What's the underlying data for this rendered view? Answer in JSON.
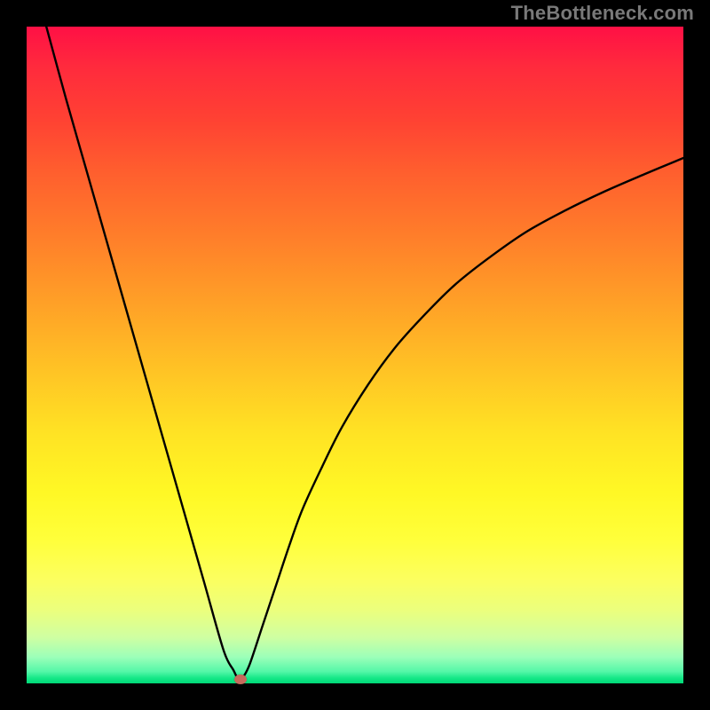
{
  "watermark": "TheBottleneck.com",
  "chart_data": {
    "type": "line",
    "title": "",
    "xlabel": "",
    "ylabel": "",
    "xlim": [
      0,
      100
    ],
    "ylim": [
      0,
      100
    ],
    "grid": false,
    "series": [
      {
        "name": "bottleneck-curve",
        "x": [
          3,
          6,
          9,
          12,
          15,
          18,
          21,
          24,
          27,
          30,
          31.5,
          32,
          32.5,
          33,
          34,
          36,
          38,
          40,
          42,
          45,
          48,
          52,
          56,
          60,
          65,
          70,
          76,
          82,
          88,
          94,
          100
        ],
        "y": [
          100,
          89,
          78.5,
          68,
          57.5,
          47,
          36.5,
          26,
          15.5,
          5,
          2,
          1,
          0.5,
          1,
          3,
          9,
          15,
          21,
          26.5,
          33,
          39,
          45.5,
          51,
          55.5,
          60.5,
          64.5,
          68.7,
          72,
          74.9,
          77.5,
          80
        ]
      }
    ],
    "marker": {
      "x": 32.5,
      "y": 0.6,
      "color": "#C66A5C"
    },
    "background_gradient": {
      "top": "#FF1045",
      "mid": "#FFE324",
      "bottom": "#00D877"
    }
  }
}
